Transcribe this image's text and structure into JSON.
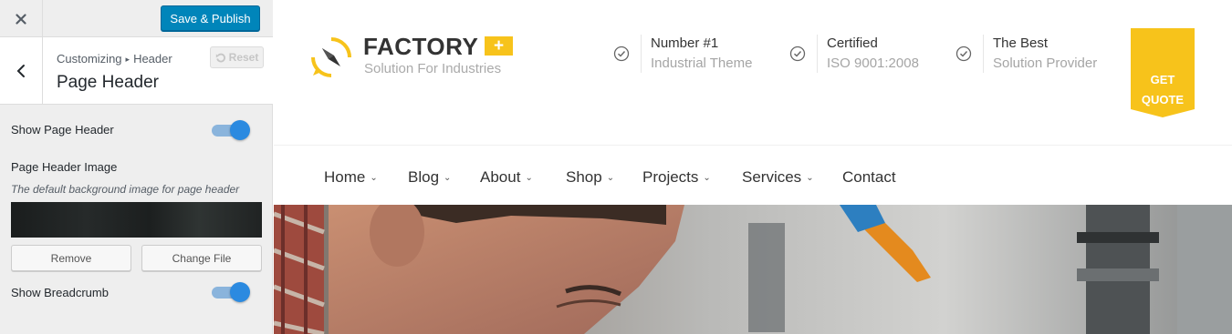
{
  "customizer": {
    "publish_label": "Save & Publish",
    "breadcrumb": {
      "root": "Customizing",
      "separator": "▸",
      "parent": "Header"
    },
    "section_title": "Page Header",
    "reset_label": "Reset",
    "controls": {
      "show_page_header": {
        "label": "Show Page Header",
        "enabled": true
      },
      "page_header_image": {
        "label": "Page Header Image",
        "description": "The default background image for page header",
        "remove_label": "Remove",
        "change_label": "Change File"
      },
      "show_breadcrumb": {
        "label": "Show Breadcrumb",
        "enabled": true
      }
    }
  },
  "site": {
    "logo": {
      "title": "FACTORY",
      "plus": "+",
      "tagline": "Solution For Industries"
    },
    "info": [
      {
        "line1": "Number #1",
        "line2": "Industrial Theme"
      },
      {
        "line1": "Certified",
        "line2": "ISO 9001:2008"
      },
      {
        "line1": "The Best",
        "line2": "Solution Provider"
      }
    ],
    "quote": {
      "line1": "GET",
      "line2": "QUOTE"
    },
    "nav": [
      {
        "label": "Home",
        "dropdown": true
      },
      {
        "label": "Blog",
        "dropdown": true
      },
      {
        "label": "About",
        "dropdown": true
      },
      {
        "label": "Shop",
        "dropdown": true
      },
      {
        "label": "Projects",
        "dropdown": true
      },
      {
        "label": "Services",
        "dropdown": true
      },
      {
        "label": "Contact",
        "dropdown": false
      }
    ],
    "nav_chevron": "⌄"
  },
  "colors": {
    "accent": "#f7c31b",
    "publish_button": "#0085ba",
    "toggle_on": "#2b8ae0"
  }
}
